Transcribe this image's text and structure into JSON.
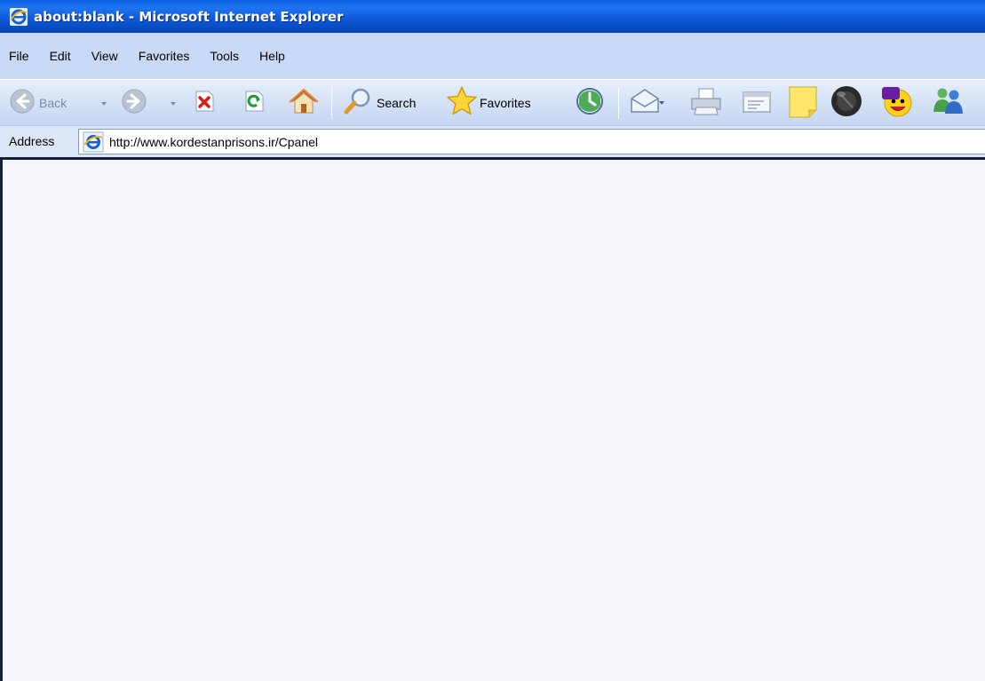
{
  "window": {
    "title": "about:blank - Microsoft Internet Explorer"
  },
  "menu": {
    "items": [
      "File",
      "Edit",
      "View",
      "Favorites",
      "Tools",
      "Help"
    ]
  },
  "toolbar": {
    "back_label": "Back",
    "search_label": "Search",
    "favorites_label": "Favorites"
  },
  "address": {
    "label": "Address",
    "url": "http://www.kordestanprisons.ir/Cpanel"
  },
  "colors": {
    "titlebar": "#0a5fe0",
    "menubar": "#c8d9f5",
    "toolbar": "#d3e1f6",
    "content_frame": "#12203c"
  },
  "icons": [
    "ie-logo-icon",
    "back-arrow-icon",
    "forward-arrow-icon",
    "dropdown-arrow-icon",
    "stop-icon",
    "refresh-icon",
    "home-icon",
    "search-icon",
    "favorites-star-icon",
    "history-icon",
    "mail-icon",
    "print-icon",
    "edit-icon",
    "note-icon",
    "messenger-ball-icon",
    "yahoo-messenger-icon",
    "msn-messenger-icon"
  ]
}
